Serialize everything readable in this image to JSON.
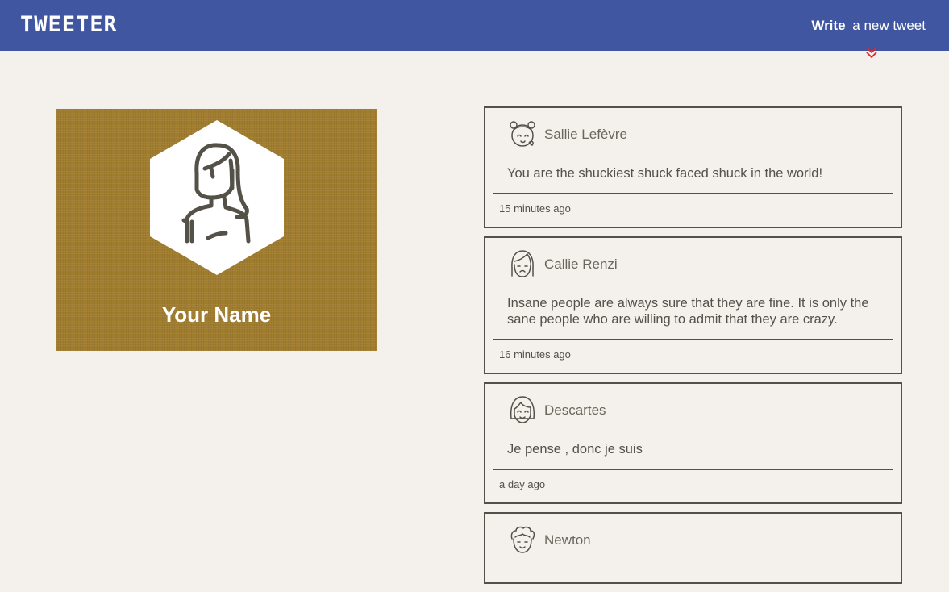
{
  "nav": {
    "brand": "TWEETER",
    "compose_strong": "Write",
    "compose_rest": "a new tweet",
    "compose_icon": "double-chevron-down-icon",
    "compose_icon_color": "#e0252c"
  },
  "profile": {
    "name": "Your Name",
    "avatar_icon": "woman-avatar-icon",
    "bg_color": "#a07c2e"
  },
  "tweets": [
    {
      "name": "Sallie Lefèvre",
      "text": "You are the shuckiest shuck faced shuck in the world!",
      "time": "15 minutes ago",
      "avatar_icon": "girl-pigtails-avatar-icon"
    },
    {
      "name": "Callie Renzi",
      "text": "Insane people are always sure that they are fine. It is only the sane people who are willing to admit that they are crazy.",
      "time": "16 minutes ago",
      "avatar_icon": "girl-avatar-icon"
    },
    {
      "name": "Descartes",
      "text": "Je pense , donc je suis",
      "time": "a day ago",
      "avatar_icon": "bob-haircut-avatar-icon"
    },
    {
      "name": "Newton",
      "text": "",
      "time": "",
      "avatar_icon": "curly-hair-avatar-icon"
    }
  ],
  "colors": {
    "navbar": "#4056a1",
    "page_bg": "#f4f1ec",
    "text": "#545149"
  }
}
